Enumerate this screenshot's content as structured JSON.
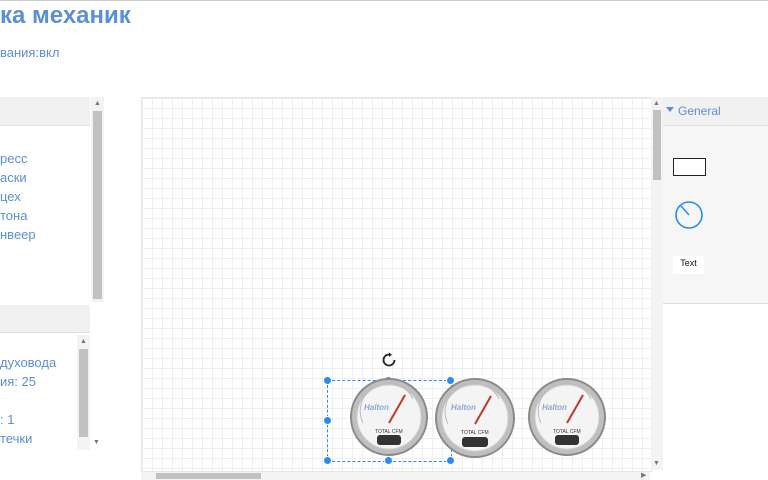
{
  "app": {
    "title": "ка механик",
    "subtitle": "вания:вкл"
  },
  "left_panel_top": {
    "items": [
      "ресс",
      "аски",
      "цех",
      "тона",
      "нвеер"
    ]
  },
  "left_panel_bottom": {
    "items": [
      "духовода",
      "ия: 25",
      "",
      ": 1",
      "течки"
    ]
  },
  "right_panel": {
    "header": "General",
    "shapes": {
      "text_label": "Text"
    }
  },
  "gauges": [
    {
      "brand": "Halton",
      "label": "TOTAL CFM"
    },
    {
      "brand": "Halton",
      "label": "TOTAL CFM"
    },
    {
      "brand": "Halton",
      "label": "TOTAL CFM"
    }
  ],
  "colors": {
    "accent": "#5b8fd6",
    "selection": "#2a8cf0"
  },
  "icons": {
    "rotate": "rotate-icon",
    "collapse": "triangle-down-icon"
  }
}
